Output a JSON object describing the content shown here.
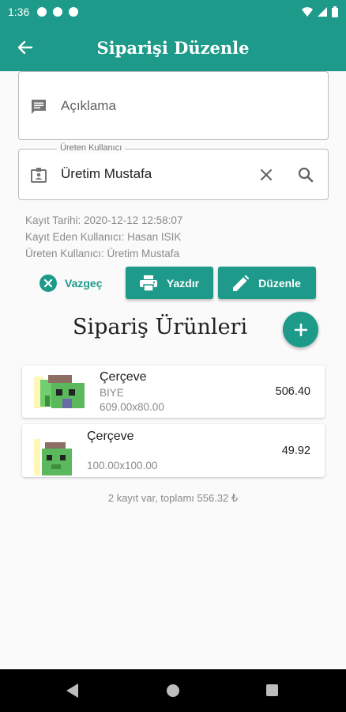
{
  "status_bar": {
    "time": "1:36"
  },
  "app_bar": {
    "title": "Siparişi Düzenle"
  },
  "form": {
    "description_placeholder": "Açıklama",
    "producer_label": "Üreten Kullanıcı",
    "producer_value": "Üretim Mustafa"
  },
  "meta": {
    "record_date": "Kayıt Tarihi: 2020-12-12 12:58:07",
    "recorded_by": "Kayıt Eden Kullanıcı: Hasan ISIK",
    "produced_by": "Üreten Kullanıcı: Üretim Mustafa"
  },
  "actions": {
    "cancel": "Vazgeç",
    "print": "Yazdır",
    "edit": "Düzenle"
  },
  "section": {
    "title": "Sipariş Ürünleri"
  },
  "items": [
    {
      "name": "Çerçeve",
      "code": "BIYE",
      "size": "609.00x80.00",
      "price": "506.40"
    },
    {
      "name": "Çerçeve",
      "code": "",
      "size": "100.00x100.00",
      "price": "49.92"
    }
  ],
  "summary": "2 kayıt var, toplamı 556.32 ₺",
  "colors": {
    "primary": "#1d9a8a"
  }
}
